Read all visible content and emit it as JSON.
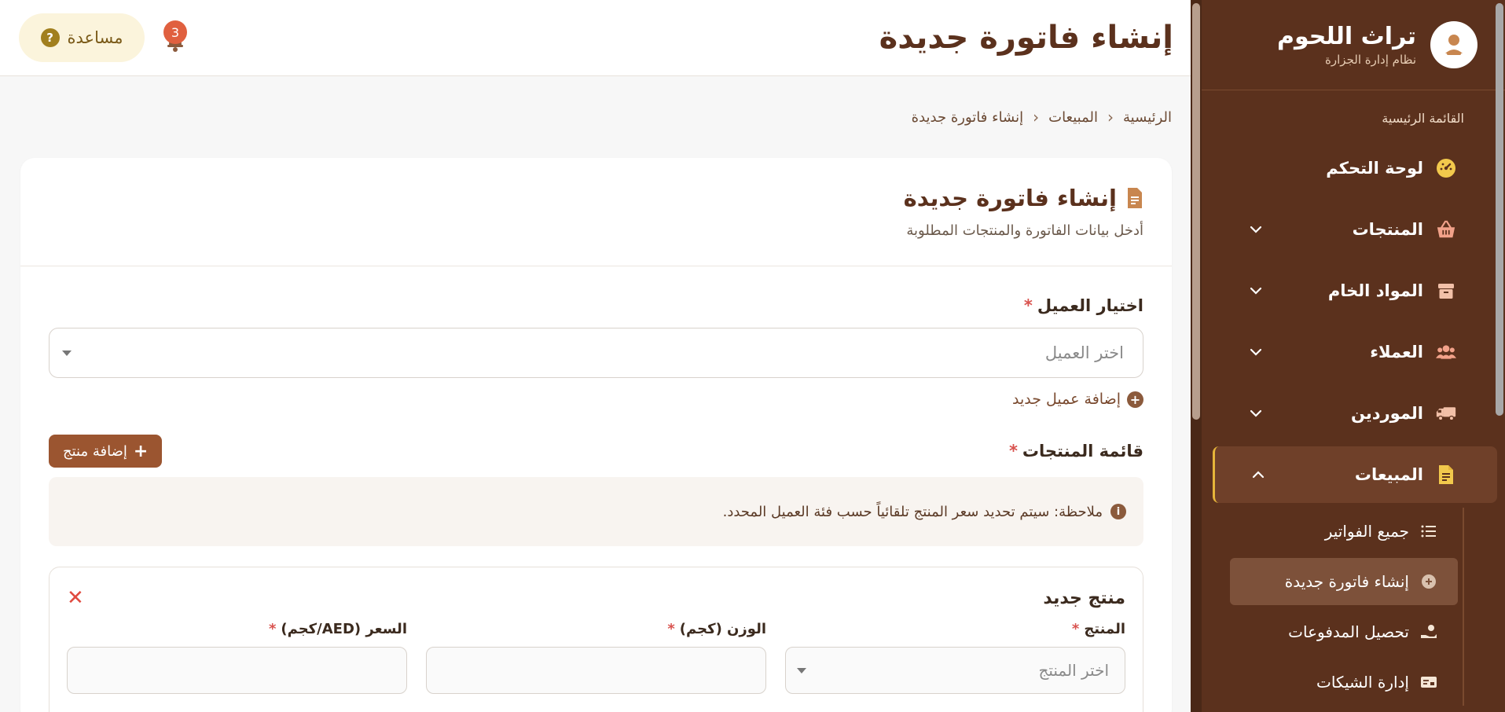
{
  "brand": {
    "title": "تراث اللحوم",
    "subtitle": "نظام إدارة الجزارة"
  },
  "sidebar": {
    "section_label": "القائمة الرئيسية",
    "items": [
      {
        "label": "لوحة التحكم",
        "icon": "dashboard-icon"
      },
      {
        "label": "المنتجات",
        "icon": "basket-icon"
      },
      {
        "label": "المواد الخام",
        "icon": "box-icon"
      },
      {
        "label": "العملاء",
        "icon": "users-icon"
      },
      {
        "label": "الموردين",
        "icon": "truck-icon"
      },
      {
        "label": "المبيعات",
        "icon": "invoice-icon"
      }
    ],
    "sub_items": [
      {
        "label": "جميع الفواتير",
        "icon": "list-icon"
      },
      {
        "label": "إنشاء فاتورة جديدة",
        "icon": "plus-circle-icon"
      },
      {
        "label": "تحصيل المدفوعات",
        "icon": "hand-coins-icon"
      },
      {
        "label": "إدارة الشيكات",
        "icon": "cheque-icon"
      }
    ]
  },
  "header": {
    "title": "إنشاء فاتورة جديدة",
    "help_label": "مساعدة",
    "notification_count": "3"
  },
  "breadcrumb": [
    "الرئيسية",
    "المبيعات",
    "إنشاء فاتورة جديدة"
  ],
  "form": {
    "title": "إنشاء فاتورة جديدة",
    "subtitle": "أدخل بيانات الفاتورة والمنتجات المطلوبة",
    "customer_label": "اختيار العميل",
    "customer_placeholder": "اختر العميل",
    "add_customer": "إضافة عميل جديد",
    "products_label": "قائمة المنتجات",
    "add_product": "إضافة منتج",
    "note": "ملاحظة: سيتم تحديد سعر المنتج تلقائياً حسب فئة العميل المحدد.",
    "product_card": {
      "title": "منتج جديد",
      "remove": "✕",
      "product_label": "المنتج",
      "product_placeholder": "اختر المنتج",
      "weight_label": "الوزن (كجم)",
      "price_label": "السعر (AED/كجم)"
    }
  },
  "colors": {
    "sidebar": "#5b311d",
    "accent": "#9b5530",
    "active_border": "#e6b53a",
    "required": "#d9534f"
  }
}
